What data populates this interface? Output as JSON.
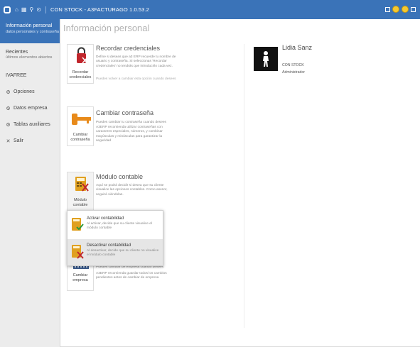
{
  "window": {
    "title": "CON STOCK - A3FACTURAGO 1.0.53.2"
  },
  "sidebar": {
    "active": {
      "title": "Información personal",
      "subtitle": "datos personales y contraseña"
    },
    "recent": {
      "title": "Recientes",
      "subtitle": "últimos elementos abiertos"
    },
    "items": [
      {
        "label": "IVAFREE"
      },
      {
        "label": "Opciones",
        "icon": "gear-icon"
      },
      {
        "label": "Datos empresa",
        "icon": "gear-icon"
      },
      {
        "label": "Tablas auxiliares",
        "icon": "gear-icon"
      },
      {
        "label": "Salir",
        "icon": "close-icon"
      }
    ]
  },
  "main": {
    "heading": "Información personal",
    "cards": {
      "credentials": {
        "icon_label": "Recordar credenciales",
        "title": "Recordar credenciales",
        "desc": "Define si deseas que a3 ERP recuerde tu nombre de usuario y contraseña. Si seleccionas 'Recordar credenciales' no tendrás que introducirlo cada vez.",
        "note": "Puedes volver a cambiar esta opción cuando desees"
      },
      "password": {
        "icon_label": "Cambiar contraseña",
        "title": "Cambiar contraseña",
        "desc": "Puedes cambiar tu contraseña cuando desees",
        "note": "A3ERP recomienda utilizar contraseñas con caracteres especiales, números, y combinar mayúsculas y minúsculas para garantizar la seguridad"
      },
      "accounting": {
        "icon_label": "Módulo contable",
        "title": "Módulo contable",
        "desc": "Aquí se podrá decidir si desea que su cliente visualice las opciones contables. Como asesor, seguirá viéndolas."
      },
      "company": {
        "icon_label": "Cambiar empresa",
        "desc_partial": "Puedes cambiar de empresa cuando desees",
        "note": "A3ERP recomienda guardar todos los cambios pendientes antes de cambiar de empresa"
      }
    },
    "dropdown": {
      "items": [
        {
          "title": "Activar contabilidad",
          "desc": "Al activar, decide que su cliente visualice el módulo contable"
        },
        {
          "title": "Desactivar contabilidad",
          "desc": "Al desactivar, decide que su cliente no visualice el módulo contable"
        }
      ]
    }
  },
  "user": {
    "name": "Lidia Sanz",
    "company": "CON STOCK",
    "role": "Administrador"
  },
  "colors": {
    "accent": "#3a73b8",
    "sidebar_bg": "#ececec"
  }
}
